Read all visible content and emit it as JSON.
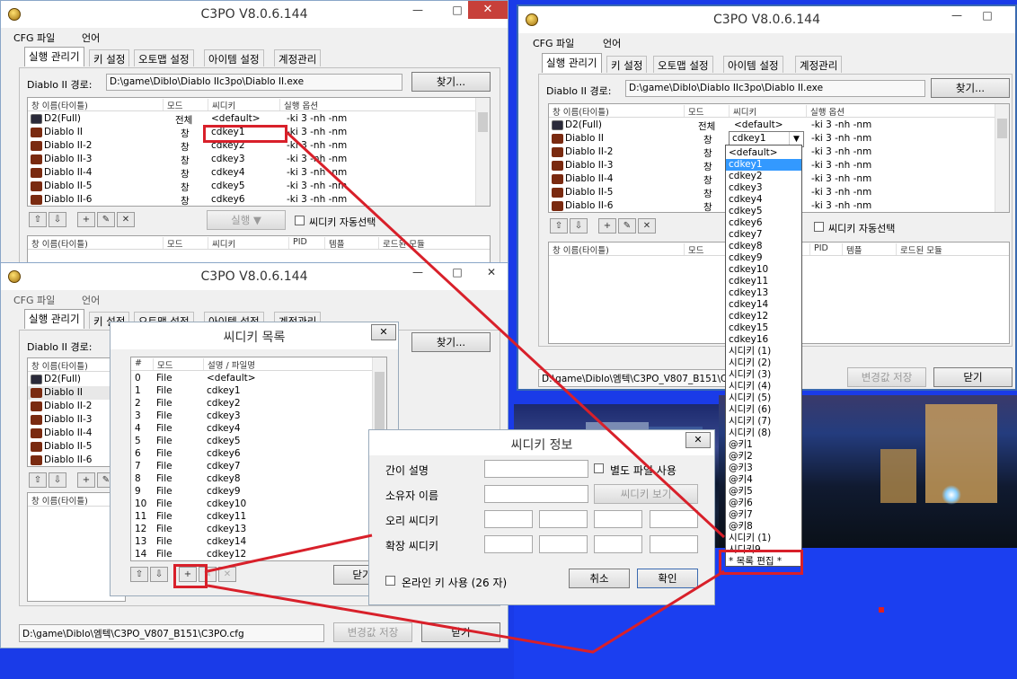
{
  "app_title": "C3PO V8.0.6.144",
  "menu": {
    "cfg": "CFG 파일",
    "lang": "언어"
  },
  "tabs": [
    "실행 관리기",
    "키 설정",
    "오토맵 설정",
    "아이템 설정",
    "계정관리"
  ],
  "path_label": "Diablo II 경로:",
  "path_value": "D:\\game\\Diblo\\Diablo IIc3po\\Diablo II.exe",
  "find_button": "찾기...",
  "list_headers": [
    "창 이름(타이틀)",
    "모드",
    "씨디키",
    "실행 옵션"
  ],
  "rows": [
    {
      "name": "D2(Full)",
      "mode": "전체",
      "key": "<default>",
      "opt": "-ki 3 -nh -nm"
    },
    {
      "name": "Diablo II",
      "mode": "창",
      "key": "cdkey1",
      "opt": "-ki 3 -nh -nm"
    },
    {
      "name": "Diablo II-2",
      "mode": "창",
      "key": "cdkey2",
      "opt": "-ki 3 -nh -nm"
    },
    {
      "name": "Diablo II-3",
      "mode": "창",
      "key": "cdkey3",
      "opt": "-ki 3 -nh -nm"
    },
    {
      "name": "Diablo II-4",
      "mode": "창",
      "key": "cdkey4",
      "opt": "-ki 3 -nh -nm"
    },
    {
      "name": "Diablo II-5",
      "mode": "창",
      "key": "cdkey5",
      "opt": "-ki 3 -nh -nm"
    },
    {
      "name": "Diablo II-6",
      "mode": "창",
      "key": "cdkey6",
      "opt": "-ki 3 -nh -nm"
    }
  ],
  "run_button": "실행 ▼",
  "auto_select_label": "씨디키 자동선택",
  "lower_headers": [
    "창 이름(타이틀)",
    "모드",
    "씨디키",
    "PID",
    "템플",
    "로드된 모듈"
  ],
  "cfg_path": "D:\\game\\Diblo\\엠텍\\C3PO_V807_B151\\C3PO.cfg",
  "cfg_path_short": "D:\\game\\Diblo\\엠텍\\C3PO_V807_B151\\C3",
  "save_button": "변경값 저장",
  "close_button": "닫기",
  "cdkey_list": {
    "title": "씨디키 목록",
    "headers": [
      "#",
      "모드",
      "설명 / 파일명"
    ],
    "rows": [
      [
        "0",
        "File",
        "<default>"
      ],
      [
        "1",
        "File",
        "cdkey1"
      ],
      [
        "2",
        "File",
        "cdkey2"
      ],
      [
        "3",
        "File",
        "cdkey3"
      ],
      [
        "4",
        "File",
        "cdkey4"
      ],
      [
        "5",
        "File",
        "cdkey5"
      ],
      [
        "6",
        "File",
        "cdkey6"
      ],
      [
        "7",
        "File",
        "cdkey7"
      ],
      [
        "8",
        "File",
        "cdkey8"
      ],
      [
        "9",
        "File",
        "cdkey9"
      ],
      [
        "10",
        "File",
        "cdkey10"
      ],
      [
        "11",
        "File",
        "cdkey11"
      ],
      [
        "12",
        "File",
        "cdkey13"
      ],
      [
        "13",
        "File",
        "cdkey14"
      ],
      [
        "14",
        "File",
        "cdkey12"
      ]
    ],
    "close": "닫기"
  },
  "cdkey_info": {
    "title": "씨디키 정보",
    "desc_label": "간이 설명",
    "separate_file_label": "별도 파일 사용",
    "owner_label": "소유자 이름",
    "view_key_button": "씨디키 보기",
    "orig_key_label": "오리 씨디키",
    "exp_key_label": "확장 씨디키",
    "online_key_label": "온라인 키 사용 (26 자)",
    "cancel": "취소",
    "ok": "확인"
  },
  "right_combo_value": "cdkey1",
  "right_row0_key": "<default>",
  "dropdown_items": [
    "<default>",
    "cdkey1",
    "cdkey2",
    "cdkey3",
    "cdkey4",
    "cdkey5",
    "cdkey6",
    "cdkey7",
    "cdkey8",
    "cdkey9",
    "cdkey10",
    "cdkey11",
    "cdkey13",
    "cdkey14",
    "cdkey12",
    "cdkey15",
    "cdkey16",
    "시디키 (1)",
    "시디키 (2)",
    "시디키 (3)",
    "시디키 (4)",
    "시디키 (5)",
    "시디키 (6)",
    "시디키 (7)",
    "시디키 (8)",
    "@키1",
    "@키2",
    "@키3",
    "@키4",
    "@키5",
    "@키6",
    "@키7",
    "@키8",
    "시디키 (1)",
    "시디키9",
    "* 목록 편집 *"
  ],
  "accent_red": "#d8202a"
}
